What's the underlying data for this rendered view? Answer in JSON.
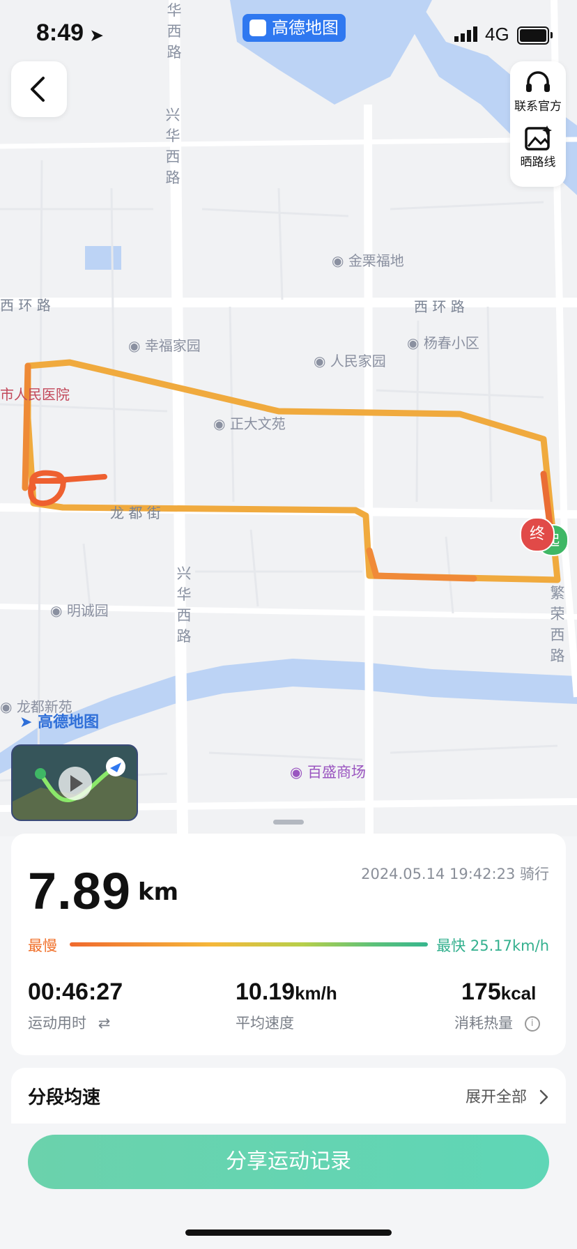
{
  "status_bar": {
    "time": "8:49",
    "carrier_app": "高德地图",
    "network": "4G"
  },
  "map": {
    "top_right": {
      "contact_label": "联系官方",
      "share_route_label": "晒路线"
    },
    "road_labels": {
      "west_ring_left": "西 环 路",
      "west_ring_right": "西 环 路",
      "longdu_street": "龙 都 街",
      "xinghua_top": "兴华西路",
      "xinghua_bottom": "兴华西路",
      "fanrong": "繁荣西路",
      "top_road": "华西路"
    },
    "pois": [
      "金栗福地",
      "幸福家园",
      "杨春小区",
      "人民家园",
      "正大文苑",
      "明诚园",
      "龙都新苑"
    ],
    "hospital": "市人民医院",
    "mall": "百盛商场",
    "watermark": "高德地图",
    "end_marker": "终",
    "start_marker": "起",
    "route_colors": {
      "slow": "#f0702a",
      "mid": "#f0b040"
    }
  },
  "summary": {
    "distance": "7.89",
    "distance_unit": "km",
    "datetime": "2024.05.14 19:42:23 骑行",
    "slowest_label": "最慢",
    "fastest_label": "最快 25.17km/h",
    "duration": "00:46:27",
    "duration_label": "运动用时",
    "avg_speed": "10.19",
    "avg_speed_unit": "km/h",
    "avg_speed_label": "平均速度",
    "calories": "175",
    "calories_unit": "kcal",
    "calories_label": "消耗热量"
  },
  "segments": {
    "title": "分段均速",
    "expand": "展开全部"
  },
  "share_button": "分享运动记录"
}
